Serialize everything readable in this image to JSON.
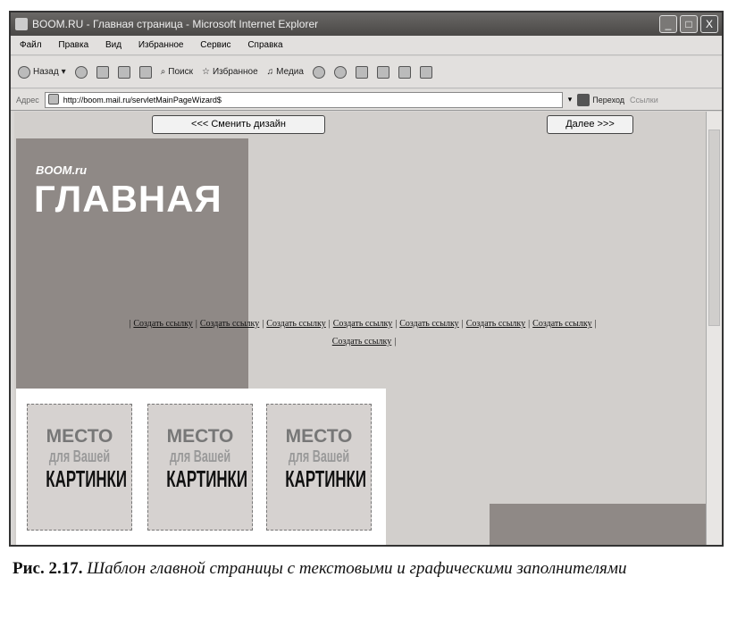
{
  "window": {
    "title": "BOOM.RU - Главная страница - Microsoft Internet Explorer",
    "minimize": "_",
    "maximize": "□",
    "close": "X"
  },
  "menu": [
    "Файл",
    "Правка",
    "Вид",
    "Избранное",
    "Сервис",
    "Справка"
  ],
  "toolbar": {
    "back": "Назад",
    "search": "Поиск",
    "favorites": "Избранное",
    "media": "Медиа"
  },
  "address": {
    "label": "Адрес",
    "url": "http://boom.mail.ru/servletMainPageWizard$",
    "go": "Переход",
    "links": "Ссылки"
  },
  "page": {
    "change_design": "<<< Сменить дизайн",
    "next": "Далее >>>",
    "logo": "BOOM.ru",
    "headline": "ГЛАВНАЯ",
    "links": [
      "Создать ссылку",
      "Создать ссылку",
      "Создать ссылку",
      "Создать ссылку",
      "Создать ссылку",
      "Создать ссылку",
      "Создать ссылку",
      "Создать ссылку"
    ],
    "placeholder": {
      "line1": "МЕСТО",
      "line2": "для Вашей",
      "line3": "КАРТИНКИ"
    }
  },
  "caption": {
    "label": "Рис. 2.17.",
    "text": "Шаблон главной страницы с текстовыми и графическими заполнителями"
  }
}
